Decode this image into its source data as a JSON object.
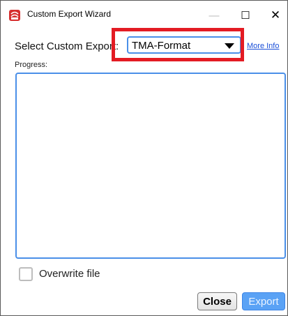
{
  "window": {
    "title": "Custom Export Wizard",
    "minimize_glyph": "—",
    "maximize_glyph": "☐",
    "close_glyph": "✕"
  },
  "form": {
    "select_label": "Select Custom Export:",
    "selected_export": "TMA-Format",
    "more_info_label": "More Info",
    "progress_label": "Progress:",
    "overwrite_label": "Overwrite file",
    "overwrite_checked": false
  },
  "buttons": {
    "close_label": "Close",
    "export_label": "Export"
  },
  "colors": {
    "highlight": "#e31b23",
    "accent": "#4a8fe8",
    "link": "#1a4fd8",
    "app_icon": "#d62d2d"
  },
  "icons": {
    "app": "app-logo-icon",
    "dropdown": "chevron-down-icon"
  }
}
